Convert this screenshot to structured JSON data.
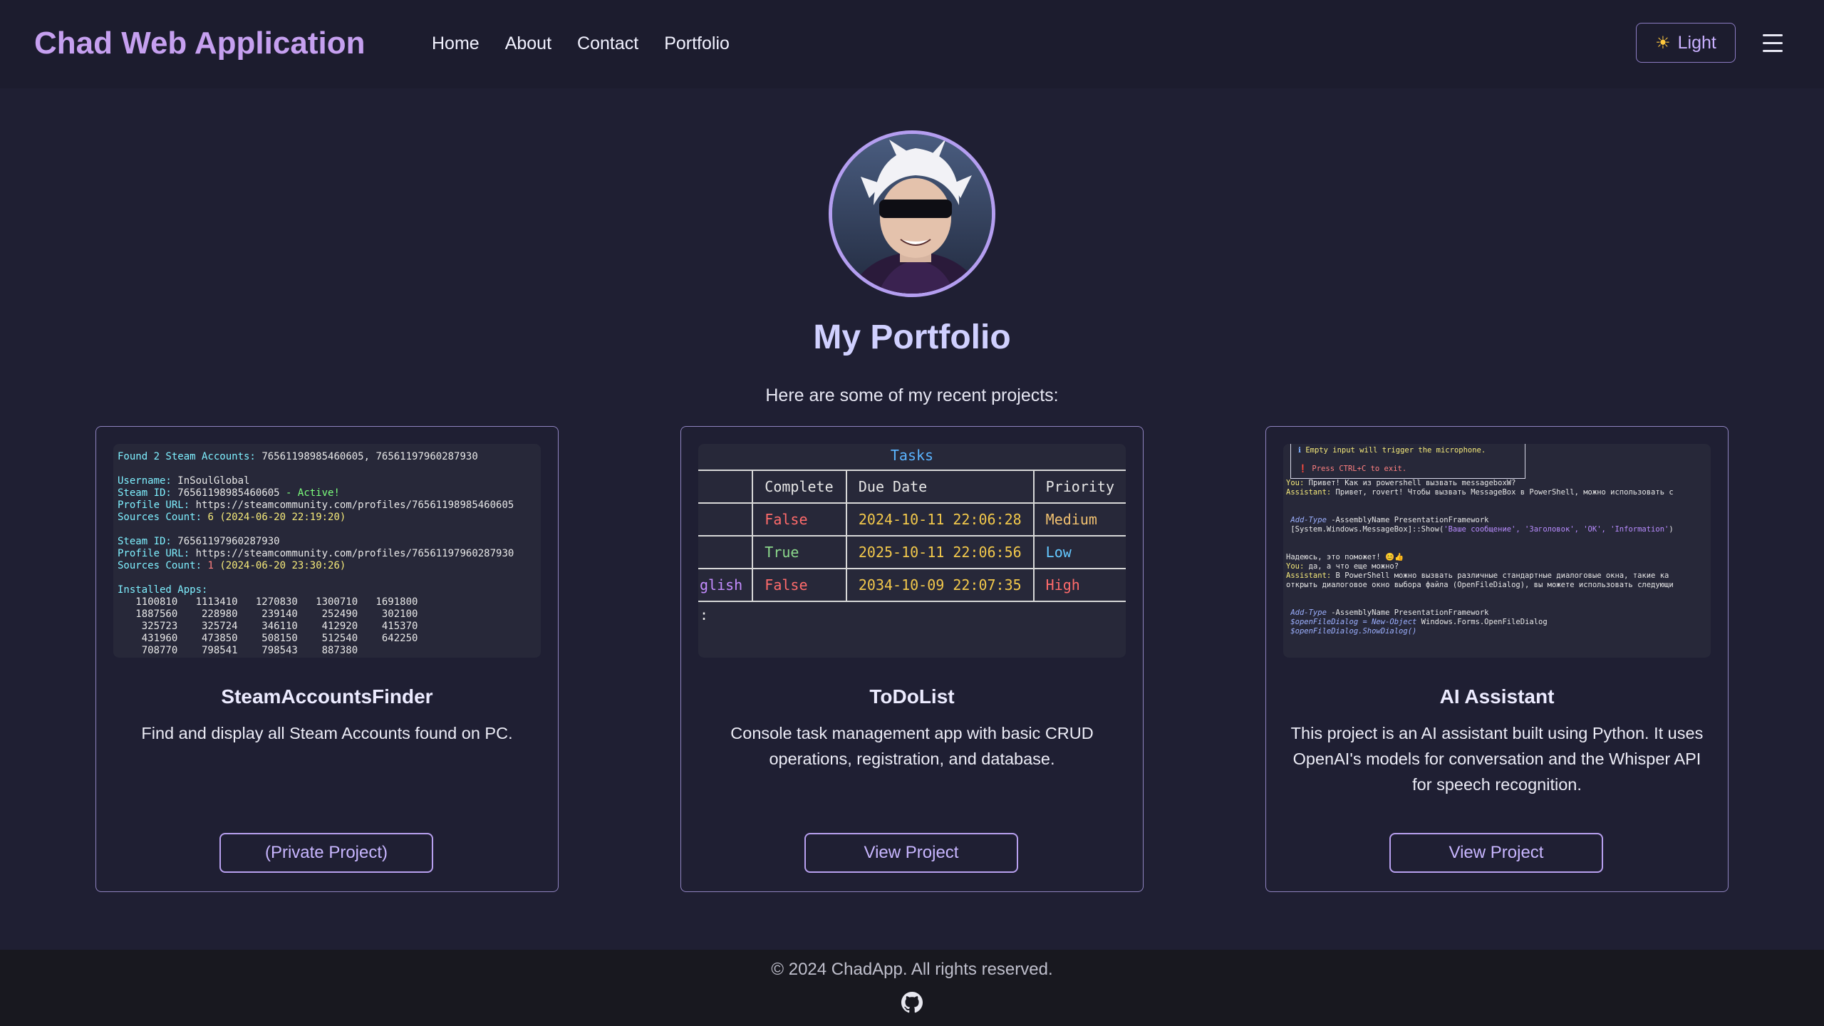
{
  "navbar": {
    "brand": "Chad Web Application",
    "links": [
      "Home",
      "About",
      "Contact",
      "Portfolio"
    ],
    "theme_label": "Light"
  },
  "hero": {
    "title": "My Portfolio",
    "subtitle": "Here are some of my recent projects:"
  },
  "projects": [
    {
      "title": "SteamAccountsFinder",
      "description": "Find and display all Steam Accounts found on PC.",
      "button": "(Private Project)",
      "screenshot": {
        "found": "Found 2 Steam Accounts:",
        "found_ids": "76561198985460605, 76561197960287930",
        "username_label": "Username:",
        "username": "InSoulGlobal",
        "id1_label": "Steam ID:",
        "id1": "76561198985460605",
        "active": "- Active!",
        "url_label": "Profile URL:",
        "url1": "https://steamcommunity.com/profiles/76561198985460605",
        "sources_label": "Sources Count:",
        "sources1_count": "6",
        "sources1_date": "(2024-06-20 22:19:20)",
        "id2": "76561197960287930",
        "url2": "https://steamcommunity.com/profiles/76561197960287930",
        "sources2_count": "1",
        "sources2_date": "(2024-06-20 23:30:26)",
        "apps_label": "Installed Apps:",
        "apps_rows": [
          "   1100810   1113410   1270830   1300710   1691800",
          "   1887560    228980    239140    252490    302100",
          "    325723    325724    346110    412920    415370",
          "    431960    473850    508150    512540    642250",
          "    708770    798541    798543    887380"
        ]
      }
    },
    {
      "title": "ToDoList",
      "description": "Console task management app with basic CRUD operations, registration, and database.",
      "button": "View Project",
      "screenshot": {
        "table_title": "Tasks",
        "headers": [
          "",
          "Complete",
          "Due Date",
          "Priority"
        ],
        "rows": [
          [
            "",
            "False",
            "2024-10-11 22:06:28",
            "Medium"
          ],
          [
            "",
            "True",
            "2025-10-11 22:06:56",
            "Low"
          ],
          [
            "glish",
            "False",
            "2034-10-09 22:07:35",
            "High"
          ]
        ],
        "prompt": ":"
      }
    },
    {
      "title": "AI Assistant",
      "description": "This project is an AI assistant built using Python. It uses OpenAI's models for conversation and the Whisper API for speech recognition.",
      "button": "View Project",
      "screenshot": {
        "info1": "Empty input will trigger the microphone.",
        "info2": "Press CTRL+C to exit.",
        "you1": "Привет! Как из powershell вызвать messageboxW?",
        "asst1": "Привет, rovert! Чтобы вызвать MessageBox в PowerShell, можно использовать с",
        "code1a": "-AssemblyName PresentationFramework",
        "code1b": "[System.Windows.MessageBox]::Show(",
        "code1_args": "'Ваше сообщение', 'Заголовок', 'OK', 'Information'",
        "extra1": "Надеюсь, это поможет! 😊👍",
        "you2": "да, а что еще можно?",
        "asst2": "В PowerShell можно вызвать различные стандартные диалоговые окна, такие ка",
        "asst2b": "открыть диалоговое окно выбора файла (OpenFileDialog), вы можете использовать следующи",
        "code2a": "-AssemblyName PresentationFramework",
        "code2b": "$openFileDialog = New-Object",
        "code2c": "Windows.Forms.OpenFileDialog",
        "code2d": "$openFileDialog.ShowDialog()"
      }
    }
  ],
  "footer": {
    "copyright": "© 2024 ChadApp. All rights reserved."
  },
  "icons": {
    "theme": "sun-icon",
    "menu": "hamburger-menu-icon",
    "github": "github-icon"
  },
  "colors": {
    "background": "#1f1f33",
    "navbar": "#1c1c2e",
    "brand": "#c6a0f0",
    "accent": "#b8a0f0",
    "footer": "#18181f"
  }
}
